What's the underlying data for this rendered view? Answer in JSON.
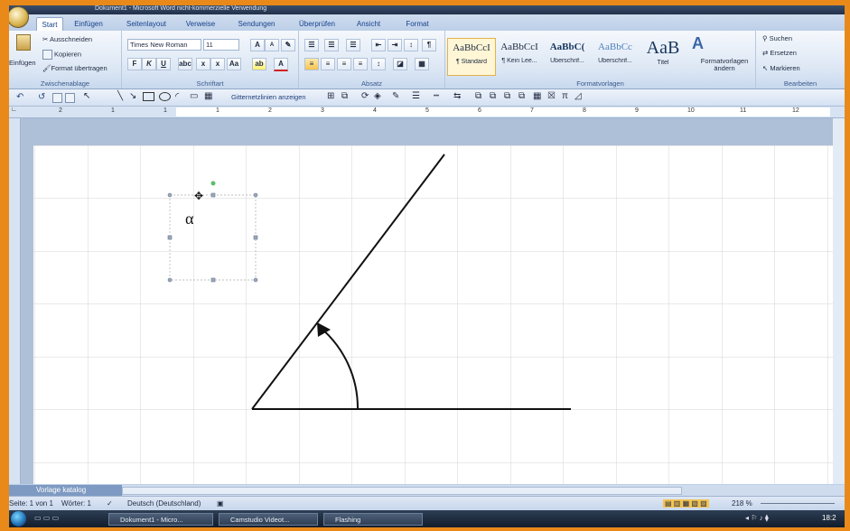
{
  "window": {
    "title": "Dokument1 - Microsoft Word nicht-kommerzielle Verwendung"
  },
  "tabs": [
    "Start",
    "Einfügen",
    "Seitenlayout",
    "Verweise",
    "Sendungen",
    "Überprüfen",
    "Ansicht",
    "Format"
  ],
  "clipboard": {
    "paste": "Einfügen",
    "cut": "Ausschneiden",
    "copy": "Kopieren",
    "format_painter": "Format übertragen",
    "label": "Zwischenablage"
  },
  "font": {
    "name": "Times New Roman",
    "size": "11",
    "label": "Schriftart"
  },
  "paragraph": {
    "label": "Absatz"
  },
  "styles": {
    "items": [
      {
        "preview": "AaBbCcI",
        "name": "¶ Standard"
      },
      {
        "preview": "AaBbCcI",
        "name": "¶ Kein Lee..."
      },
      {
        "preview": "AaBbC(",
        "name": "Überschrif..."
      },
      {
        "preview": "AaBbCc",
        "name": "Überschrif..."
      },
      {
        "preview": "AaB",
        "name": "Titel"
      }
    ],
    "change_label": "Formatvorlagen ändern",
    "label": "Formatvorlagen"
  },
  "editing": {
    "find": "Suchen",
    "replace": "Ersetzen",
    "select": "Markieren",
    "label": "Bearbeiten"
  },
  "drawing_toolbar": {
    "gridlines_label": "Gitternetzlinien anzeigen"
  },
  "ruler": {
    "ticks": [
      "2",
      "1",
      "1",
      "1",
      "2",
      "3",
      "4",
      "5",
      "6",
      "7",
      "8",
      "9",
      "10",
      "11",
      "12"
    ]
  },
  "document": {
    "angle_symbol": "α"
  },
  "bottom": {
    "vorlage_katalog": "Vorlage katalog"
  },
  "statusbar": {
    "page": "Seite: 1 von 1",
    "words": "Wörter: 1",
    "language": "Deutsch (Deutschland)",
    "zoom": "218 %"
  },
  "taskbar": {
    "items": [
      "Dokument1 - Micro...",
      "Camstudio Videot...",
      "Flashing"
    ],
    "clock": "18:2"
  }
}
